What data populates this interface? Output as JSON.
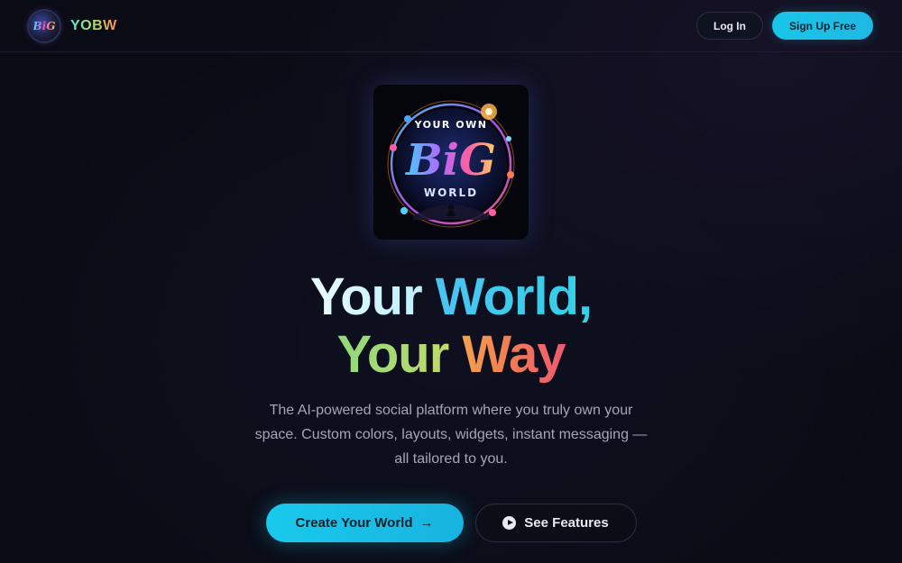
{
  "header": {
    "brand_name": "YOBW",
    "logo_text": "BiG",
    "login_label": "Log In",
    "signup_label": "Sign Up Free"
  },
  "hero": {
    "image_text": {
      "top": "YOUR OWN",
      "middle": "BiG",
      "bottom": "WORLD"
    },
    "title_line1_part1": "Your ",
    "title_line1_part2": "World,",
    "title_line2_part1": "Your ",
    "title_line2_part2": "Way",
    "subtitle": "The AI-powered social platform where you truly own your space. Custom colors, layouts, widgets, instant messaging — all tailored to you.",
    "primary_cta": "Create Your World",
    "primary_cta_icon": "arrow-right-icon",
    "secondary_cta": "See Features",
    "secondary_cta_icon": "play-circle-icon"
  },
  "colors": {
    "background": "#0b0d16",
    "accent": "#18c6e8",
    "title_world": "#4cc3f2",
    "title_your2": "#8fd97c",
    "title_way": "#f07a55"
  }
}
